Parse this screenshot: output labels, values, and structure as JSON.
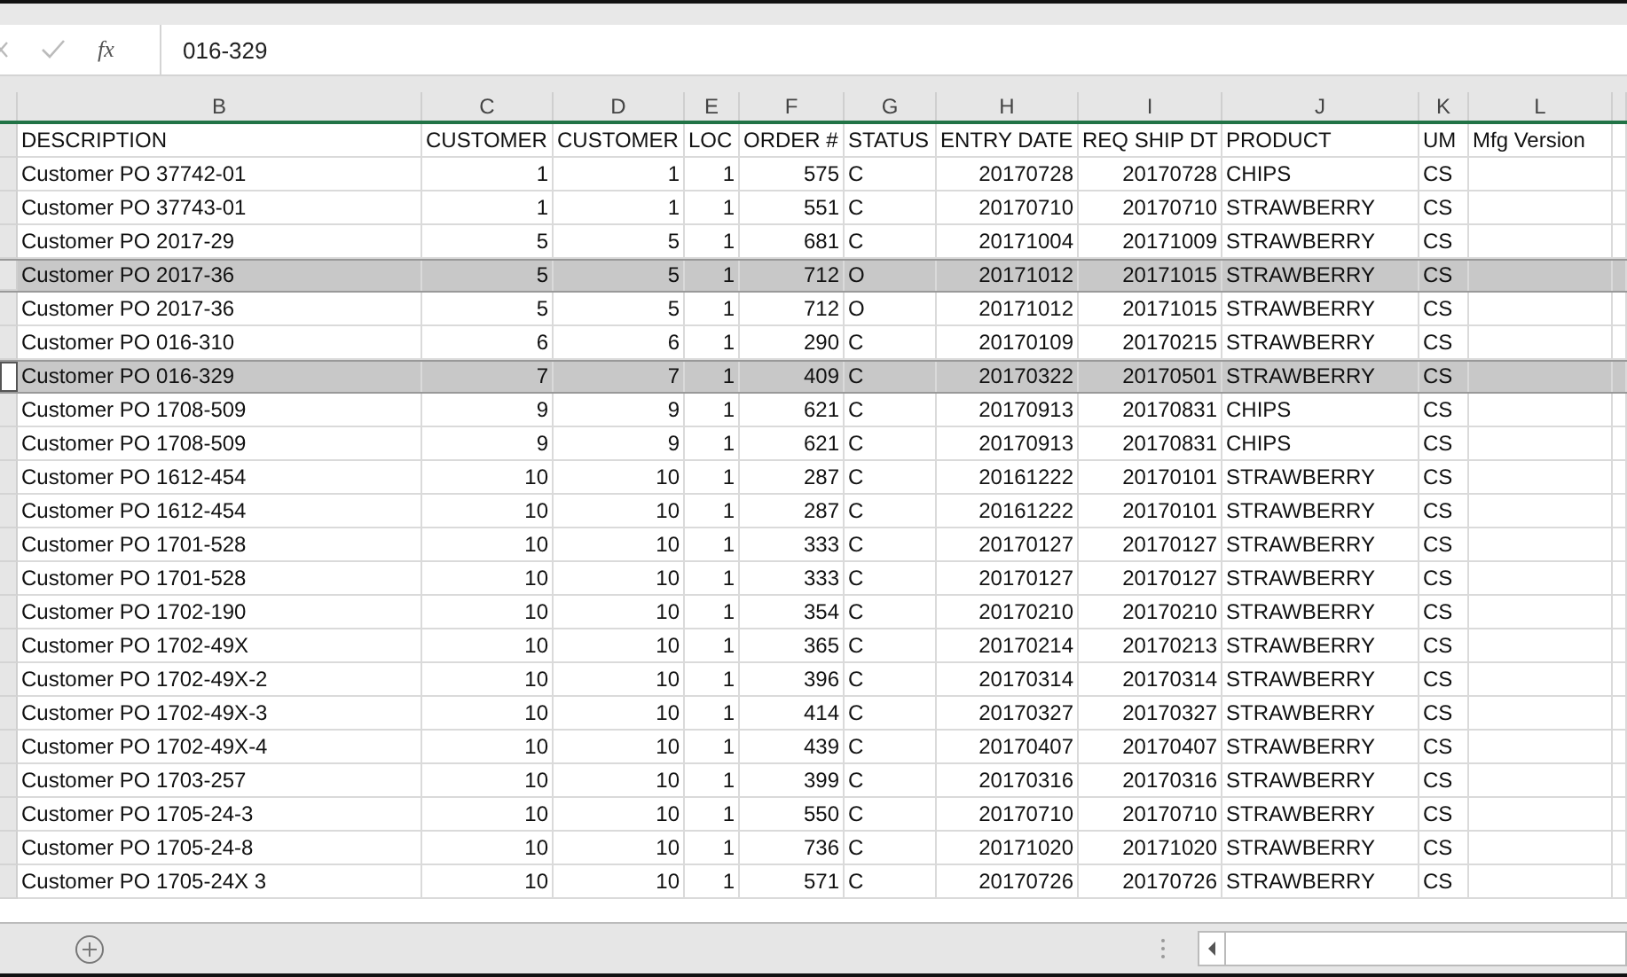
{
  "formula_bar": {
    "fx": "fx",
    "value": "016-329"
  },
  "columns": [
    {
      "letter": "B",
      "kind": "text"
    },
    {
      "letter": "C",
      "kind": "number"
    },
    {
      "letter": "D",
      "kind": "number"
    },
    {
      "letter": "E",
      "kind": "number"
    },
    {
      "letter": "F",
      "kind": "number"
    },
    {
      "letter": "G",
      "kind": "text"
    },
    {
      "letter": "H",
      "kind": "number"
    },
    {
      "letter": "I",
      "kind": "number"
    },
    {
      "letter": "J",
      "kind": "text"
    },
    {
      "letter": "K",
      "kind": "text"
    },
    {
      "letter": "L",
      "kind": "text"
    }
  ],
  "rows": [
    {
      "selected": false,
      "active": false,
      "cells": [
        "DESCRIPTION",
        "CUSTOMER",
        "CUSTOMER",
        "LOC",
        "ORDER #",
        "STATUS",
        "ENTRY DATE",
        "REQ SHIP DT",
        "PRODUCT",
        "UM",
        "Mfg Version"
      ]
    },
    {
      "selected": false,
      "active": false,
      "cells": [
        "Customer PO  37742-01",
        "1",
        "1",
        "1",
        "575",
        "C",
        "20170728",
        "20170728",
        "CHIPS",
        "CS",
        ""
      ]
    },
    {
      "selected": false,
      "active": false,
      "cells": [
        "Customer PO  37743-01",
        "1",
        "1",
        "1",
        "551",
        "C",
        "20170710",
        "20170710",
        "STRAWBERRY",
        "CS",
        ""
      ]
    },
    {
      "selected": false,
      "active": false,
      "cells": [
        "Customer PO  2017-29",
        "5",
        "5",
        "1",
        "681",
        "C",
        "20171004",
        "20171009",
        "STRAWBERRY",
        "CS",
        ""
      ]
    },
    {
      "selected": true,
      "active": false,
      "cells": [
        "Customer PO  2017-36",
        "5",
        "5",
        "1",
        "712",
        "O",
        "20171012",
        "20171015",
        "STRAWBERRY",
        "CS",
        ""
      ]
    },
    {
      "selected": false,
      "active": false,
      "cells": [
        "Customer PO  2017-36",
        "5",
        "5",
        "1",
        "712",
        "O",
        "20171012",
        "20171015",
        "STRAWBERRY",
        "CS",
        ""
      ]
    },
    {
      "selected": false,
      "active": false,
      "cells": [
        "Customer PO  016-310",
        "6",
        "6",
        "1",
        "290",
        "C",
        "20170109",
        "20170215",
        "STRAWBERRY",
        "CS",
        ""
      ]
    },
    {
      "selected": true,
      "active": true,
      "cells": [
        "Customer PO  016-329",
        "7",
        "7",
        "1",
        "409",
        "C",
        "20170322",
        "20170501",
        "STRAWBERRY",
        "CS",
        ""
      ]
    },
    {
      "selected": false,
      "active": false,
      "cells": [
        "Customer PO  1708-509",
        "9",
        "9",
        "1",
        "621",
        "C",
        "20170913",
        "20170831",
        "CHIPS",
        "CS",
        ""
      ]
    },
    {
      "selected": false,
      "active": false,
      "cells": [
        "Customer PO  1708-509",
        "9",
        "9",
        "1",
        "621",
        "C",
        "20170913",
        "20170831",
        "CHIPS",
        "CS",
        ""
      ]
    },
    {
      "selected": false,
      "active": false,
      "cells": [
        "Customer PO  1612-454",
        "10",
        "10",
        "1",
        "287",
        "C",
        "20161222",
        "20170101",
        "STRAWBERRY",
        "CS",
        ""
      ]
    },
    {
      "selected": false,
      "active": false,
      "cells": [
        "Customer PO  1612-454",
        "10",
        "10",
        "1",
        "287",
        "C",
        "20161222",
        "20170101",
        "STRAWBERRY",
        "CS",
        ""
      ]
    },
    {
      "selected": false,
      "active": false,
      "cells": [
        "Customer PO  1701-528",
        "10",
        "10",
        "1",
        "333",
        "C",
        "20170127",
        "20170127",
        "STRAWBERRY",
        "CS",
        ""
      ]
    },
    {
      "selected": false,
      "active": false,
      "cells": [
        "Customer PO  1701-528",
        "10",
        "10",
        "1",
        "333",
        "C",
        "20170127",
        "20170127",
        "STRAWBERRY",
        "CS",
        ""
      ]
    },
    {
      "selected": false,
      "active": false,
      "cells": [
        "Customer PO  1702-190",
        "10",
        "10",
        "1",
        "354",
        "C",
        "20170210",
        "20170210",
        "STRAWBERRY",
        "CS",
        ""
      ]
    },
    {
      "selected": false,
      "active": false,
      "cells": [
        "Customer PO  1702-49X",
        "10",
        "10",
        "1",
        "365",
        "C",
        "20170214",
        "20170213",
        "STRAWBERRY",
        "CS",
        ""
      ]
    },
    {
      "selected": false,
      "active": false,
      "cells": [
        "Customer PO  1702-49X-2",
        "10",
        "10",
        "1",
        "396",
        "C",
        "20170314",
        "20170314",
        "STRAWBERRY",
        "CS",
        ""
      ]
    },
    {
      "selected": false,
      "active": false,
      "cells": [
        "Customer PO  1702-49X-3",
        "10",
        "10",
        "1",
        "414",
        "C",
        "20170327",
        "20170327",
        "STRAWBERRY",
        "CS",
        ""
      ]
    },
    {
      "selected": false,
      "active": false,
      "cells": [
        "Customer PO  1702-49X-4",
        "10",
        "10",
        "1",
        "439",
        "C",
        "20170407",
        "20170407",
        "STRAWBERRY",
        "CS",
        ""
      ]
    },
    {
      "selected": false,
      "active": false,
      "cells": [
        "Customer PO  1703-257",
        "10",
        "10",
        "1",
        "399",
        "C",
        "20170316",
        "20170316",
        "STRAWBERRY",
        "CS",
        ""
      ]
    },
    {
      "selected": false,
      "active": false,
      "cells": [
        "Customer PO  1705-24-3",
        "10",
        "10",
        "1",
        "550",
        "C",
        "20170710",
        "20170710",
        "STRAWBERRY",
        "CS",
        ""
      ]
    },
    {
      "selected": false,
      "active": false,
      "cells": [
        "Customer PO  1705-24-8",
        "10",
        "10",
        "1",
        "736",
        "C",
        "20171020",
        "20171020",
        "STRAWBERRY",
        "CS",
        ""
      ]
    },
    {
      "selected": false,
      "active": false,
      "cells": [
        "Customer PO  1705-24X 3",
        "10",
        "10",
        "1",
        "571",
        "C",
        "20170726",
        "20170726",
        "STRAWBERRY",
        "CS",
        ""
      ]
    }
  ]
}
